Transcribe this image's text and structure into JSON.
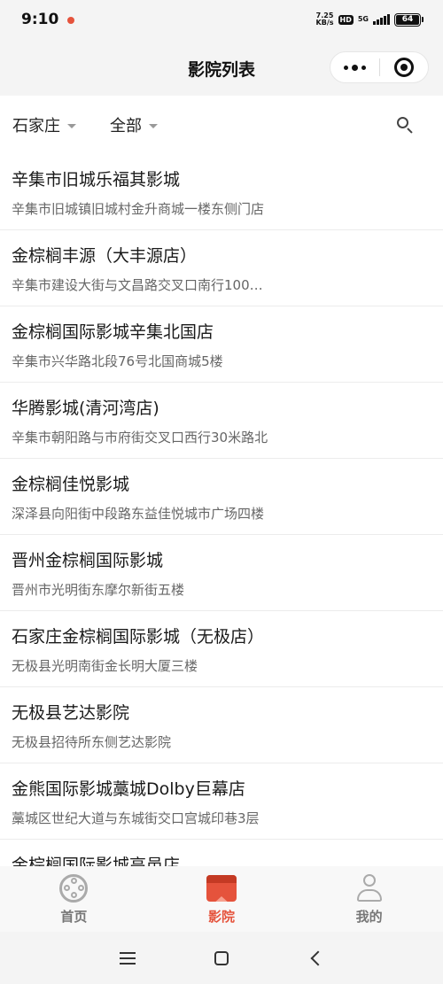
{
  "status_bar": {
    "time": "9:10",
    "net_speed_value": "7.25",
    "net_speed_unit": "KB/s",
    "hd": "HD",
    "network": "5G",
    "battery": "64"
  },
  "nav": {
    "title": "影院列表"
  },
  "filters": {
    "city": "石家庄",
    "district": "全部"
  },
  "cinemas": [
    {
      "name": "辛集市旧城乐福其影城",
      "address": "辛集市旧城镇旧城村金升商城一楼东侧门店"
    },
    {
      "name": "金棕榈丰源（大丰源店）",
      "address": "辛集市建设大街与文昌路交叉口南行100…"
    },
    {
      "name": "金棕榈国际影城辛集北国店",
      "address": "辛集市兴华路北段76号北国商城5楼"
    },
    {
      "name": "华腾影城(清河湾店)",
      "address": "辛集市朝阳路与市府街交叉口西行30米路北"
    },
    {
      "name": "金棕榈佳悦影城",
      "address": "深泽县向阳街中段路东益佳悦城市广场四楼"
    },
    {
      "name": "晋州金棕榈国际影城",
      "address": "晋州市光明街东摩尔新街五楼"
    },
    {
      "name": "石家庄金棕榈国际影城（无极店）",
      "address": "无极县光明南街金长明大厦三楼"
    },
    {
      "name": "无极县艺达影院",
      "address": "无极县招待所东侧艺达影院"
    },
    {
      "name": "金熊国际影城藁城Dolby巨幕店",
      "address": "藁城区世纪大道与东城街交口宫城印巷3层"
    },
    {
      "name": "金棕榈国际影城高邑店",
      "address": ""
    }
  ],
  "tabs": {
    "home": "首页",
    "cinema": "影院",
    "mine": "我的"
  },
  "colors": {
    "accent": "#e5533c"
  }
}
